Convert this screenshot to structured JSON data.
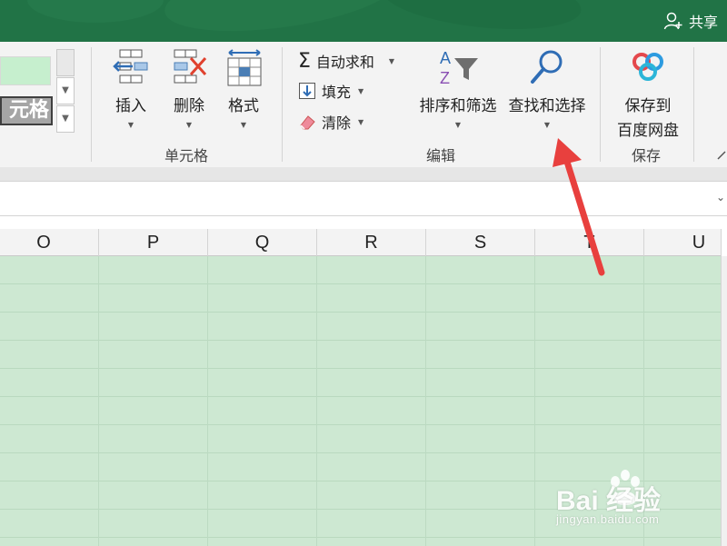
{
  "titlebar": {
    "share_label": "共享"
  },
  "ribbon": {
    "styles": {
      "swatch_text": "元格"
    },
    "cells_group": {
      "label": "单元格",
      "insert": "插入",
      "delete": "删除",
      "format": "格式"
    },
    "editing_group": {
      "label": "编辑",
      "autosum": "自动求和",
      "fill": "填充",
      "clear": "清除",
      "sort_filter": "排序和筛选",
      "find_select": "查找和选择"
    },
    "save_group": {
      "label": "保存",
      "save_line1": "保存到",
      "save_line2": "百度网盘"
    }
  },
  "grid": {
    "columns": [
      "O",
      "P",
      "Q",
      "R",
      "S",
      "T",
      "U"
    ]
  },
  "watermark": {
    "brand": "Bai 经验",
    "site": "jingyan.baidu.com"
  },
  "colors": {
    "title_bar": "#217346",
    "cell_fill": "#cde8d2",
    "arrow": "#e8403e",
    "good_style": "#c6efce",
    "check_style": "#a5a5a5"
  }
}
